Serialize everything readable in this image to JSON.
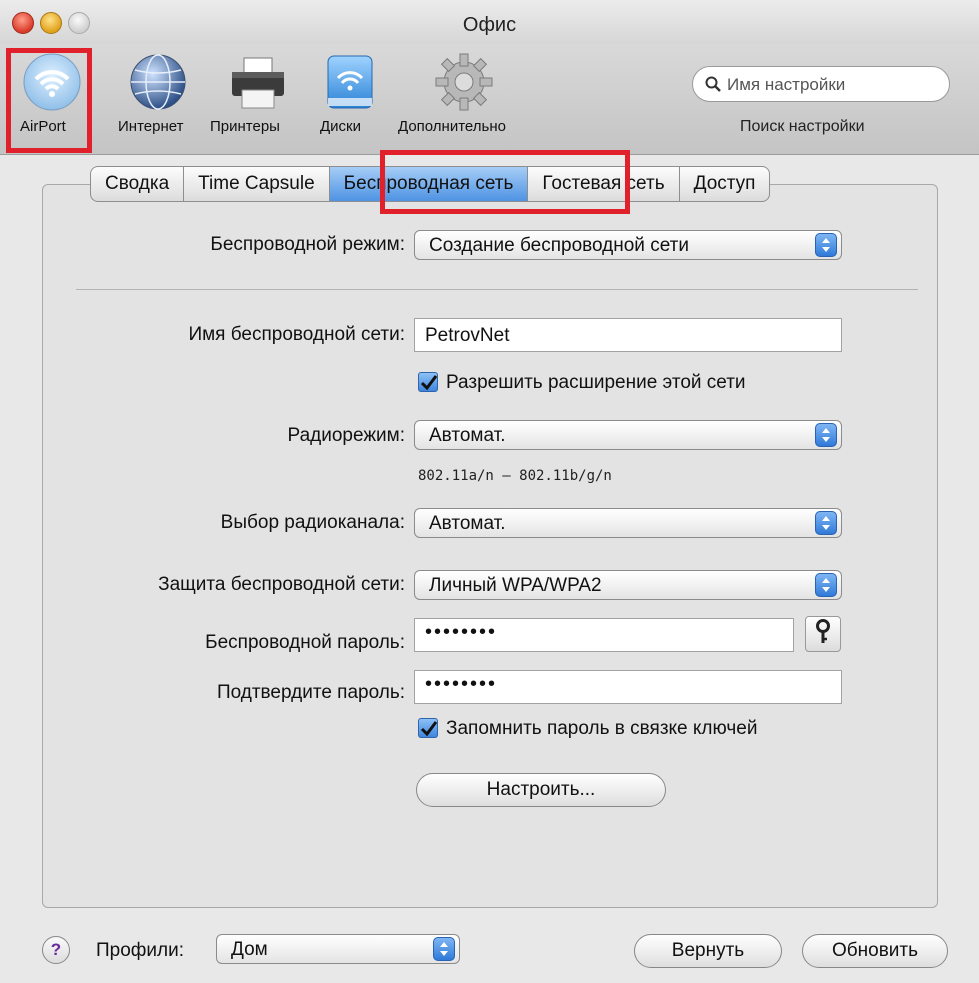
{
  "window": {
    "title": "Офис"
  },
  "toolbar": {
    "items": [
      {
        "label": "AirPort",
        "icon": "airport-wifi-icon"
      },
      {
        "label": "Интернет",
        "icon": "globe-icon"
      },
      {
        "label": "Принтеры",
        "icon": "printer-icon"
      },
      {
        "label": "Диски",
        "icon": "disk-icon"
      },
      {
        "label": "Дополнительно",
        "icon": "gear-icon"
      }
    ],
    "search": {
      "placeholder": "Имя настройки",
      "caption": "Поиск настройки"
    }
  },
  "tabs": [
    {
      "label": "Сводка"
    },
    {
      "label": "Time Capsule"
    },
    {
      "label": "Беспроводная сеть",
      "active": true
    },
    {
      "label": "Гостевая сеть"
    },
    {
      "label": "Доступ"
    }
  ],
  "form": {
    "wireless_mode": {
      "label": "Беспроводной режим:",
      "value": "Создание беспроводной сети"
    },
    "network_name": {
      "label": "Имя беспроводной сети:",
      "value": "PetrovNet"
    },
    "allow_extend": {
      "label": "Разрешить расширение этой сети",
      "checked": true
    },
    "radio_mode": {
      "label": "Радиорежим:",
      "value": "Автомат.",
      "hint": "802.11a/n – 802.11b/g/n"
    },
    "channel": {
      "label": "Выбор радиоканала:",
      "value": "Автомат."
    },
    "security": {
      "label": "Защита беспроводной сети:",
      "value": "Личный WPA/WPA2"
    },
    "password": {
      "label": "Беспроводной пароль:",
      "value": "••••••••"
    },
    "confirm_password": {
      "label": "Подтвердите пароль:",
      "value": "••••••••"
    },
    "remember_keychain": {
      "label": "Запомнить пароль в связке ключей",
      "checked": true
    },
    "configure_button": "Настроить..."
  },
  "footer": {
    "help": "?",
    "profiles_label": "Профили:",
    "profile_value": "Дом",
    "revert_button": "Вернуть",
    "update_button": "Обновить"
  },
  "colors": {
    "highlight": "#e0202a",
    "accent": "#4e93e3"
  }
}
